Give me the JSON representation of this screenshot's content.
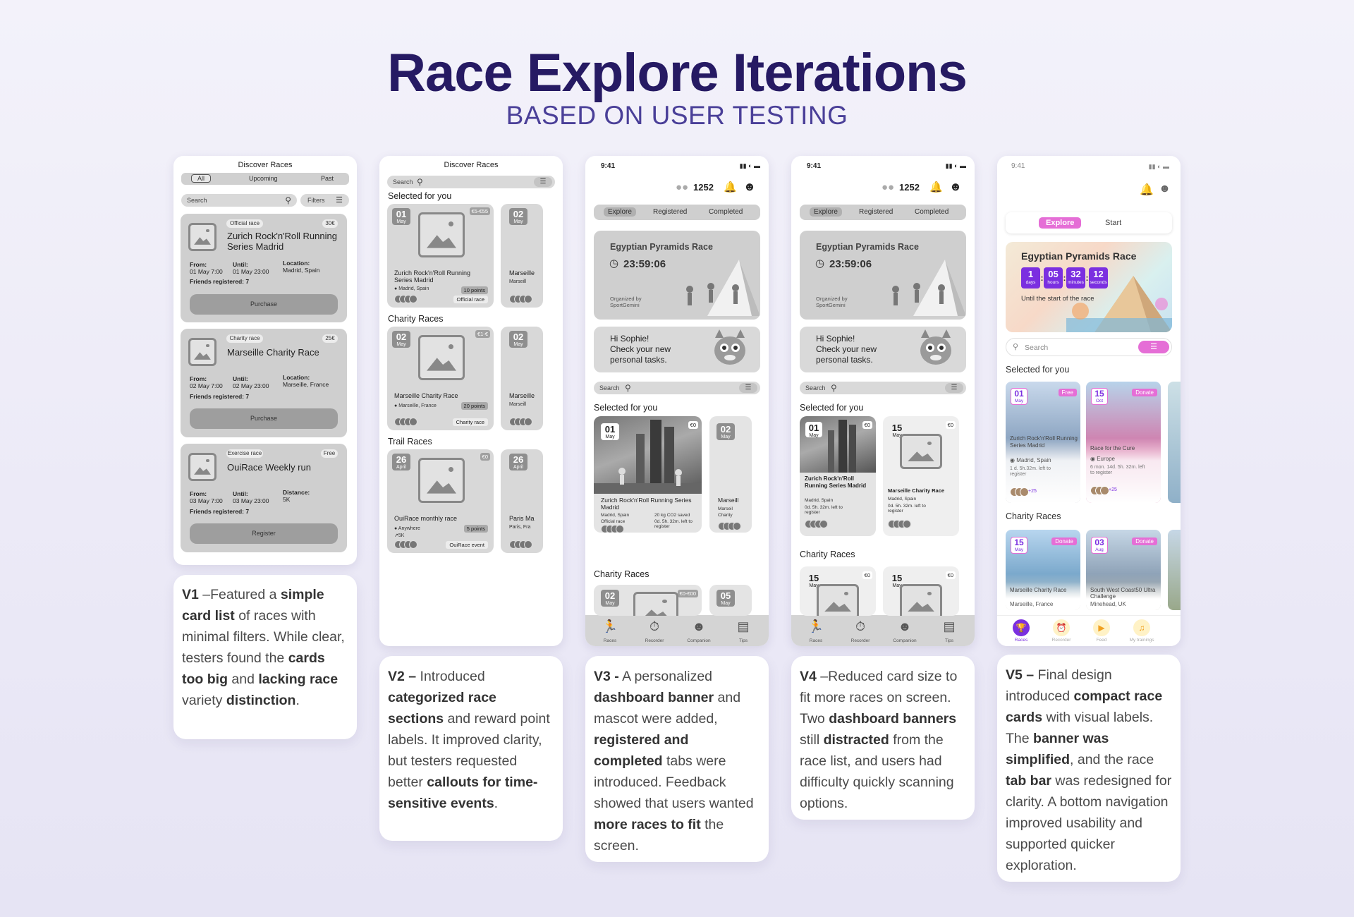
{
  "title": "Race Explore Iterations",
  "subtitle": "BASED ON USER TESTING",
  "v1": {
    "header": "Discover Races",
    "tabs": [
      "All",
      "Upcoming",
      "Past"
    ],
    "search": "Search",
    "filters": "Filters",
    "cards": [
      {
        "type": "Official race",
        "price": "30€",
        "name": "Zurich Rock'n'Roll Running Series Madrid",
        "from_label": "From:",
        "from": "01 May 7:00",
        "until_label": "Until:",
        "until": "01 May 23:00",
        "loc_label": "Location:",
        "loc": "Madrid, Spain",
        "friends": "Friends registered: 7",
        "button": "Purchase"
      },
      {
        "type": "Charity race",
        "price": "25€",
        "name": "Marseille Charity Race",
        "from_label": "From:",
        "from": "02 May 7:00",
        "until_label": "Until:",
        "until": "02 May 23:00",
        "loc_label": "Location:",
        "loc": "Marseille, France",
        "friends": "Friends registered: 7",
        "button": "Purchase"
      },
      {
        "type": "Exercise race",
        "price": "Free",
        "name": "OuiRace Weekly run",
        "from_label": "From:",
        "from": "03 May 7:00",
        "until_label": "Until:",
        "until": "03 May 23:00",
        "loc_label": "Distance:",
        "loc": "5K",
        "friends": "Friends registered: 7",
        "button": "Register"
      }
    ]
  },
  "v2": {
    "header": "Discover Races",
    "search": "Search",
    "sections": [
      {
        "title": "Selected for you",
        "day": "01",
        "month": "May",
        "tag": "€5-€55",
        "name": "Zurich Rock'n'Roll Running Series Madrid",
        "loc": "Madrid, Spain",
        "points": "10 points",
        "type": "Official race",
        "next_day": "02",
        "next_month": "May",
        "next_name": "Marseille",
        "next_loc": "Marseill"
      },
      {
        "title": "Charity Races",
        "day": "02",
        "month": "May",
        "tag": "€1-€",
        "name": "Marseille Charity Race",
        "loc": "Marseille, France",
        "points": "20 points",
        "type": "Charity race",
        "next_day": "02",
        "next_month": "May",
        "next_name": "Marseille",
        "next_loc": "Marseill"
      },
      {
        "title": "Trail Races",
        "day": "26",
        "month": "April",
        "tag": "€0",
        "name": "OuiRace monthly race",
        "loc": "Anywhere",
        "dist": "5K",
        "points": "5 points",
        "type": "OuiRace event",
        "next_day": "26",
        "next_month": "April",
        "next_name": "Paris Ma",
        "next_loc": "Paris, Fra"
      }
    ]
  },
  "v3": {
    "time": "9:41",
    "points": "1252",
    "tabs": [
      "Explore",
      "Registered",
      "Completed"
    ],
    "banner_title": "Egyptian Pyramids Race",
    "countdown": "23:59:06",
    "organized_label": "Organized by",
    "organizer": "SportGemini",
    "greet1": "Hi Sophie!",
    "greet2": "Check your new",
    "greet3": "personal tasks.",
    "search": "Search",
    "selected": "Selected for you",
    "card": {
      "day": "01",
      "month": "May",
      "price": "€0",
      "name": "Zurich Rock'n'Roll Running Series Madrid",
      "loc": "Madrid, Spain",
      "co2": "20 kg CO2 saved",
      "type": "Official race",
      "left": "0d. 5h. 32m. left to register"
    },
    "next": {
      "day": "02",
      "month": "May",
      "name": "Marseill",
      "loc": "Marseil",
      "type": "Charity"
    },
    "charity": "Charity Races",
    "c1": {
      "day": "02",
      "month": "May",
      "price": "€0-€00"
    },
    "c2": {
      "day": "05",
      "month": "May"
    },
    "nav": [
      "Races",
      "Recorder",
      "Companion",
      "Tips"
    ]
  },
  "v4": {
    "time": "9:41",
    "points": "1252",
    "tabs": [
      "Explore",
      "Registered",
      "Completed"
    ],
    "banner_title": "Egyptian Pyramids Race",
    "countdown": "23:59:06",
    "organized_label": "Organized by",
    "organizer": "SportGemini",
    "greet1": "Hi Sophie!",
    "greet2": "Check your new",
    "greet3": "personal tasks.",
    "search": "Search",
    "selected": "Selected for you",
    "cards": [
      {
        "day": "01",
        "month": "May",
        "price": "€0",
        "name": "Zurich Rock'n'Roll Running Series Madrid",
        "loc": "Madrid, Spain",
        "left": "0d. 5h. 32m. left to register"
      },
      {
        "day": "15",
        "month": "May",
        "price": "€0",
        "name": "Marseille Charity Race",
        "loc": "Madrid, Spain",
        "left": "0d. 5h. 32m. left to register"
      }
    ],
    "charity": "Charity Races",
    "c1": {
      "day": "15",
      "month": "May",
      "price": "€0"
    },
    "c2": {
      "day": "15",
      "month": "May",
      "price": "€0"
    },
    "nav": [
      "Races",
      "Recorder",
      "Companion",
      "Tips"
    ]
  },
  "v5": {
    "time": "9:41",
    "tabs": [
      "Explore",
      "Start"
    ],
    "banner_title": "Egyptian Pyramids Race",
    "countdown": [
      {
        "v": "1",
        "u": "days"
      },
      {
        "v": "05",
        "u": "hours"
      },
      {
        "v": "32",
        "u": "minutes"
      },
      {
        "v": "12",
        "u": "seconds"
      }
    ],
    "until": "Until the start of the race",
    "search": "Search",
    "selected": "Selected for you",
    "cards": [
      {
        "day": "01",
        "month": "May",
        "badge": "Free",
        "name": "Zurich Rock'n'Roll Running Series Madrid",
        "loc": "Madrid, Spain",
        "left": "1 d. 5h.32m. left to register",
        "friends": "+25"
      },
      {
        "day": "15",
        "month": "Oct",
        "badge": "Donate",
        "name": "Race for the Cure",
        "loc": "Europe",
        "left": "6 mon. 14d. 5h. 32m. left to register",
        "friends": "+25"
      }
    ],
    "charity": "Charity Races",
    "charity_cards": [
      {
        "day": "15",
        "month": "May",
        "badge": "Donate",
        "name": "Marseille Charity Race",
        "loc": "Marseille, France"
      },
      {
        "day": "03",
        "month": "Aug",
        "badge": "Donate",
        "name": "South West Coast50 Ultra Challenge",
        "loc": "Minehead, UK"
      }
    ],
    "nav": [
      "Races",
      "Recorder",
      "Feed",
      "My trainings"
    ],
    "colors": {
      "accent": "#7b2fe0",
      "pink": "#e56ed6"
    }
  },
  "descriptions": {
    "v1": [
      {
        "t": "V1",
        "b": true
      },
      {
        "t": " –Featured a "
      },
      {
        "t": "simple card list",
        "b": true
      },
      {
        "t": " of races with minimal filters. While clear, testers found the "
      },
      {
        "t": "cards too big",
        "b": true
      },
      {
        "t": " and "
      },
      {
        "t": "lacking race",
        "b": true
      },
      {
        "t": " variety "
      },
      {
        "t": "distinction",
        "b": true
      },
      {
        "t": "."
      }
    ],
    "v2": [
      {
        "t": "V2 –",
        "b": true
      },
      {
        "t": " Introduced "
      },
      {
        "t": "categorized race sections",
        "b": true
      },
      {
        "t": " and reward point labels. It improved clarity, but testers requested better "
      },
      {
        "t": "callouts for time-sensitive events",
        "b": true
      },
      {
        "t": "."
      }
    ],
    "v3": [
      {
        "t": "V3 -",
        "b": true
      },
      {
        "t": " A personalized "
      },
      {
        "t": "dashboard banner",
        "b": true
      },
      {
        "t": " and mascot were added, "
      },
      {
        "t": "registered and completed",
        "b": true
      },
      {
        "t": " tabs were introduced. Feedback showed that users wanted "
      },
      {
        "t": "more races to fit",
        "b": true
      },
      {
        "t": " the screen."
      }
    ],
    "v4": [
      {
        "t": "V4",
        "b": true
      },
      {
        "t": " –Reduced card size to fit more races on screen. Two "
      },
      {
        "t": "dashboard banners",
        "b": true
      },
      {
        "t": " still "
      },
      {
        "t": "distracted",
        "b": true
      },
      {
        "t": " from the race list, and users had difficulty quickly scanning options."
      }
    ],
    "v5": [
      {
        "t": "V5 –",
        "b": true
      },
      {
        "t": " Final design introduced "
      },
      {
        "t": "compact race cards",
        "b": true
      },
      {
        "t": " with visual labels. The "
      },
      {
        "t": "banner was simplified",
        "b": true
      },
      {
        "t": ", and the race "
      },
      {
        "t": "tab bar",
        "b": true
      },
      {
        "t": " was redesigned for clarity. A bottom navigation improved usability and supported quicker exploration."
      }
    ]
  }
}
